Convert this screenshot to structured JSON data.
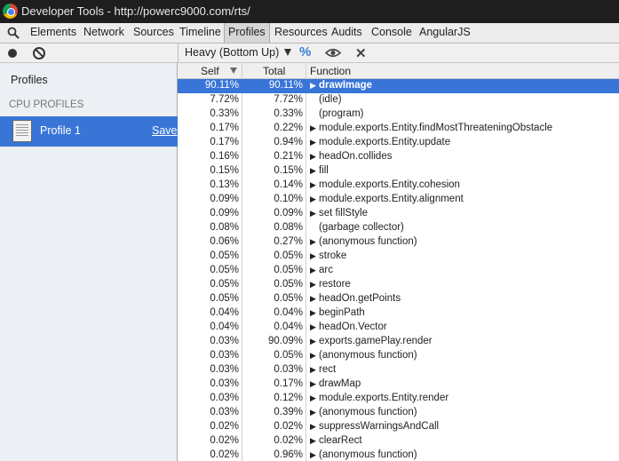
{
  "window": {
    "title": "Developer Tools - http://powerc9000.com/rts/"
  },
  "tabs": [
    {
      "label": "Elements"
    },
    {
      "label": "Network"
    },
    {
      "label": "Sources"
    },
    {
      "label": "Timeline"
    },
    {
      "label": "Profiles",
      "active": true
    },
    {
      "label": "Resources"
    },
    {
      "label": "Audits"
    },
    {
      "label": "Console"
    },
    {
      "label": "AngularJS"
    }
  ],
  "toolbar": {
    "view_mode": "Heavy (Bottom Up)",
    "percent_label": "%",
    "icons": [
      "record-icon",
      "clear-icon",
      "view-caret-icon",
      "percent-toggle-icon",
      "focus-eye-icon",
      "exclude-x-icon"
    ]
  },
  "sidebar": {
    "title": "Profiles",
    "section_label": "CPU PROFILES",
    "items": [
      {
        "name": "Profile 1",
        "save_label": "Save",
        "selected": true
      }
    ]
  },
  "grid": {
    "columns": {
      "self": "Self",
      "total": "Total",
      "function": "Function"
    },
    "rows": [
      {
        "self": "90.11%",
        "total": "90.11%",
        "fn": "drawImage",
        "expandable": true,
        "selected": true
      },
      {
        "self": "7.72%",
        "total": "7.72%",
        "fn": "(idle)",
        "expandable": false
      },
      {
        "self": "0.33%",
        "total": "0.33%",
        "fn": "(program)",
        "expandable": false
      },
      {
        "self": "0.17%",
        "total": "0.22%",
        "fn": "module.exports.Entity.findMostThreateningObstacle",
        "expandable": true
      },
      {
        "self": "0.17%",
        "total": "0.94%",
        "fn": "module.exports.Entity.update",
        "expandable": true
      },
      {
        "self": "0.16%",
        "total": "0.21%",
        "fn": "headOn.collides",
        "expandable": true
      },
      {
        "self": "0.15%",
        "total": "0.15%",
        "fn": "fill",
        "expandable": true
      },
      {
        "self": "0.13%",
        "total": "0.14%",
        "fn": "module.exports.Entity.cohesion",
        "expandable": true
      },
      {
        "self": "0.09%",
        "total": "0.10%",
        "fn": "module.exports.Entity.alignment",
        "expandable": true
      },
      {
        "self": "0.09%",
        "total": "0.09%",
        "fn": "set fillStyle",
        "expandable": true
      },
      {
        "self": "0.08%",
        "total": "0.08%",
        "fn": "(garbage collector)",
        "expandable": false
      },
      {
        "self": "0.06%",
        "total": "0.27%",
        "fn": "(anonymous function)",
        "expandable": true
      },
      {
        "self": "0.05%",
        "total": "0.05%",
        "fn": "stroke",
        "expandable": true
      },
      {
        "self": "0.05%",
        "total": "0.05%",
        "fn": "arc",
        "expandable": true
      },
      {
        "self": "0.05%",
        "total": "0.05%",
        "fn": "restore",
        "expandable": true
      },
      {
        "self": "0.05%",
        "total": "0.05%",
        "fn": "headOn.getPoints",
        "expandable": true
      },
      {
        "self": "0.04%",
        "total": "0.04%",
        "fn": "beginPath",
        "expandable": true
      },
      {
        "self": "0.04%",
        "total": "0.04%",
        "fn": "headOn.Vector",
        "expandable": true
      },
      {
        "self": "0.03%",
        "total": "90.09%",
        "fn": "exports.gamePlay.render",
        "expandable": true
      },
      {
        "self": "0.03%",
        "total": "0.05%",
        "fn": "(anonymous function)",
        "expandable": true
      },
      {
        "self": "0.03%",
        "total": "0.03%",
        "fn": "rect",
        "expandable": true
      },
      {
        "self": "0.03%",
        "total": "0.17%",
        "fn": "drawMap",
        "expandable": true
      },
      {
        "self": "0.03%",
        "total": "0.12%",
        "fn": "module.exports.Entity.render",
        "expandable": true
      },
      {
        "self": "0.03%",
        "total": "0.39%",
        "fn": "(anonymous function)",
        "expandable": true
      },
      {
        "self": "0.02%",
        "total": "0.02%",
        "fn": "suppressWarningsAndCall",
        "expandable": true
      },
      {
        "self": "0.02%",
        "total": "0.02%",
        "fn": "clearRect",
        "expandable": true
      },
      {
        "self": "0.02%",
        "total": "0.96%",
        "fn": "(anonymous function)",
        "expandable": true
      }
    ]
  }
}
